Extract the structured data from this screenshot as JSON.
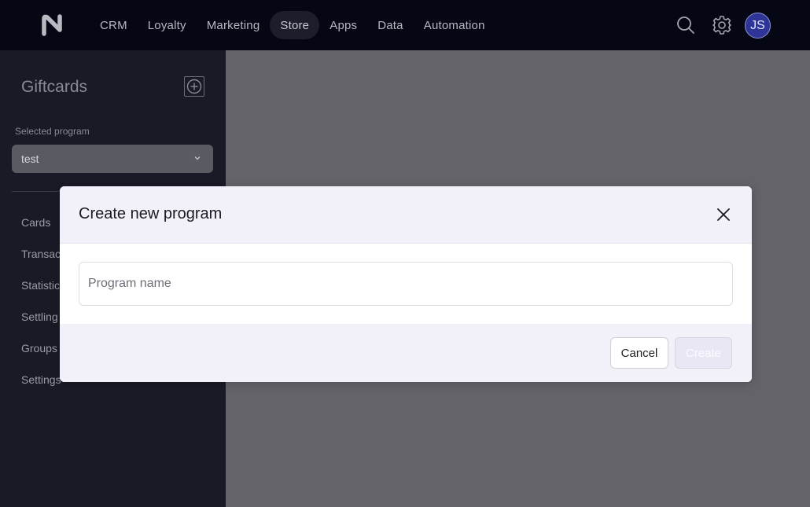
{
  "nav": {
    "items": [
      {
        "label": "CRM",
        "active": false
      },
      {
        "label": "Loyalty",
        "active": false
      },
      {
        "label": "Marketing",
        "active": false
      },
      {
        "label": "Store",
        "active": true
      },
      {
        "label": "Apps",
        "active": false
      },
      {
        "label": "Data",
        "active": false
      },
      {
        "label": "Automation",
        "active": false
      }
    ],
    "avatar_initials": "JS"
  },
  "sidebar": {
    "title": "Giftcards",
    "selected_program_label": "Selected program",
    "selected_program_value": "test",
    "items": [
      {
        "label": "Cards"
      },
      {
        "label": "Transac"
      },
      {
        "label": "Statistic"
      },
      {
        "label": "Settling"
      },
      {
        "label": "Groups"
      },
      {
        "label": "Settings"
      }
    ]
  },
  "modal": {
    "title": "Create new program",
    "input_placeholder": "Program name",
    "input_value": "",
    "cancel_label": "Cancel",
    "create_label": "Create"
  },
  "colors": {
    "topbar": "#050814",
    "sidebar": "#1a1a26",
    "overlay": "#636369",
    "modal_header": "#f2f1fa",
    "avatar": "#2e3597"
  }
}
